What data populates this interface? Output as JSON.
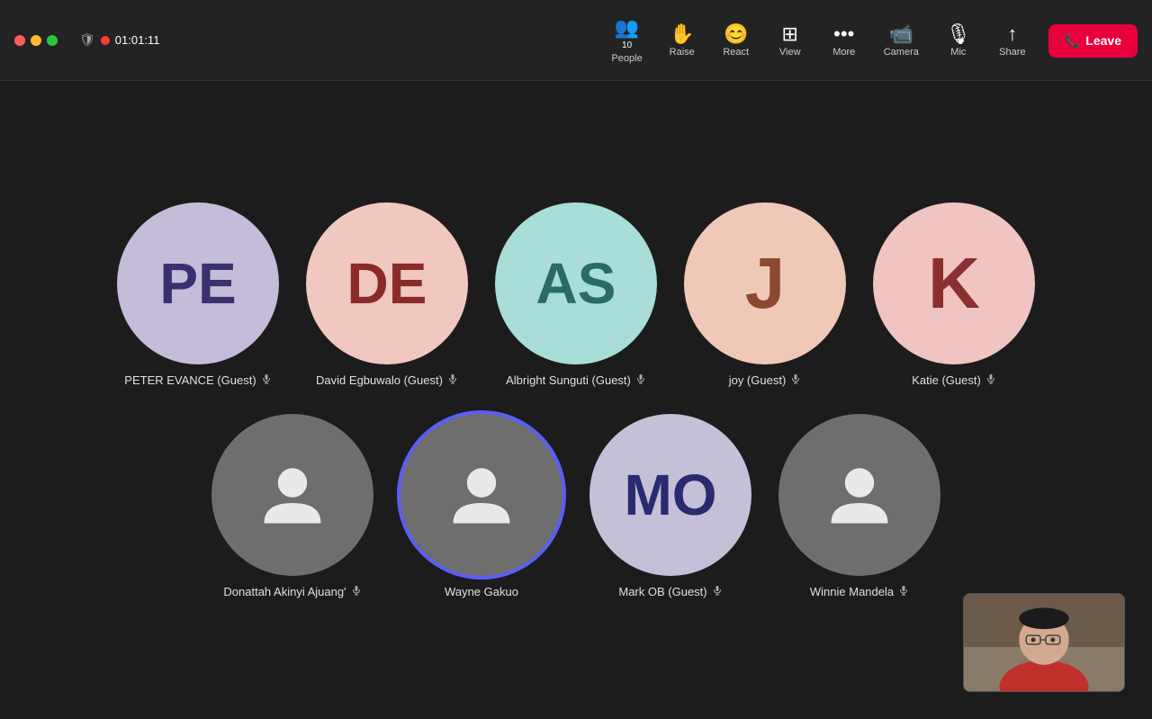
{
  "window": {
    "traffic_lights": [
      "close",
      "minimize",
      "maximize"
    ],
    "recording_dot": true,
    "timer": "01:01:11"
  },
  "toolbar": {
    "people_label": "People",
    "people_count": "10",
    "raise_label": "Raise",
    "react_label": "React",
    "view_label": "View",
    "more_label": "More",
    "camera_label": "Camera",
    "mic_label": "Mic",
    "share_label": "Share",
    "leave_label": "Leave"
  },
  "participants": {
    "row1": [
      {
        "id": "pe",
        "initials": "PE",
        "name": "PETER EVANCE (Guest)",
        "bg": "#c4bcd8",
        "text_color": "#3a3070",
        "has_mic": true,
        "is_person": false
      },
      {
        "id": "de",
        "initials": "DE",
        "name": "David Egbuwalo (Guest)",
        "bg": "#f0c8c0",
        "text_color": "#8b2a2a",
        "has_mic": true,
        "is_person": false
      },
      {
        "id": "as",
        "initials": "AS",
        "name": "Albright Sunguti (Guest)",
        "bg": "#a8ddd8",
        "text_color": "#2a6b65",
        "has_mic": true,
        "is_person": false
      },
      {
        "id": "j",
        "initials": "J",
        "name": "joy (Guest)",
        "bg": "#f0c8b8",
        "text_color": "#8b4a30",
        "has_mic": true,
        "is_person": false
      },
      {
        "id": "k",
        "initials": "K",
        "name": "Katie (Guest)",
        "bg": "#f0c4c0",
        "text_color": "#8b3030",
        "has_mic": true,
        "is_person": false
      }
    ],
    "row2": [
      {
        "id": "da",
        "initials": "",
        "name": "Donattah Akinyi Ajuang'",
        "bg": "#777",
        "text_color": "#fff",
        "has_mic": true,
        "is_person": true,
        "speaking": false
      },
      {
        "id": "wg",
        "initials": "",
        "name": "Wayne Gakuo",
        "bg": "#777",
        "text_color": "#fff",
        "has_mic": false,
        "is_person": true,
        "speaking": true
      },
      {
        "id": "mo",
        "initials": "MO",
        "name": "Mark OB (Guest)",
        "bg": "#c4c0d8",
        "text_color": "#2a2a70",
        "has_mic": true,
        "is_person": false,
        "speaking": false
      },
      {
        "id": "wm",
        "initials": "",
        "name": "Winnie Mandela",
        "bg": "#777",
        "text_color": "#fff",
        "has_mic": true,
        "is_person": true,
        "speaking": false
      }
    ]
  }
}
